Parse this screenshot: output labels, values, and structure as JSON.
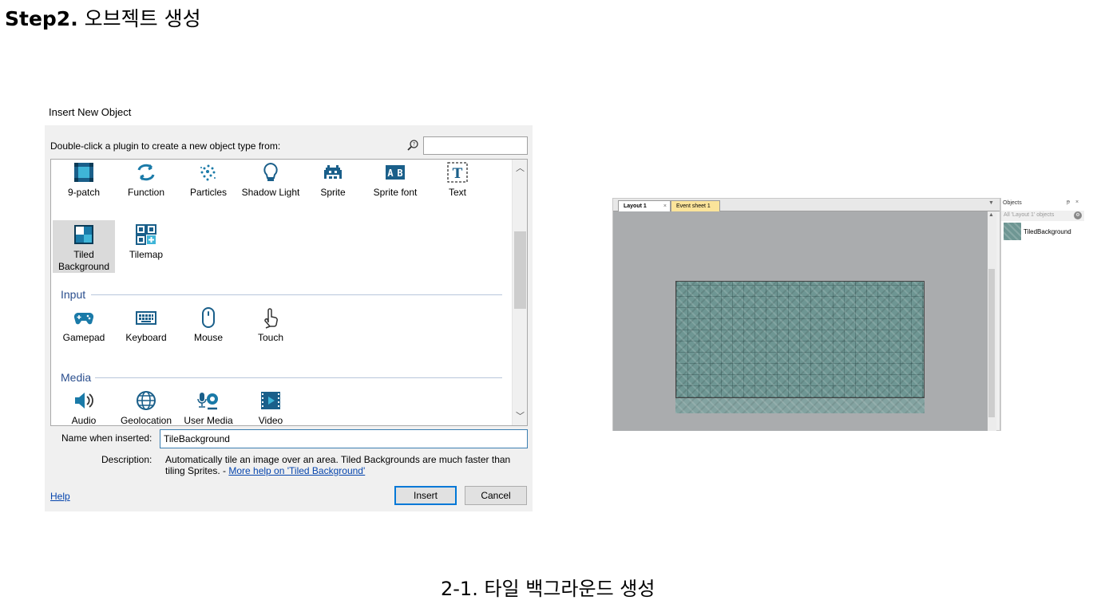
{
  "step": {
    "prefix": "Step2.",
    "title": "오브젝트 생성"
  },
  "dialog": {
    "title": "Insert New Object",
    "instruction": "Double-click a plugin to create a new object type from:",
    "search_value": "",
    "plugins": [
      {
        "label": "9-patch",
        "icon": "nine-patch-icon"
      },
      {
        "label": "Function",
        "icon": "function-icon"
      },
      {
        "label": "Particles",
        "icon": "particles-icon"
      },
      {
        "label": "Shadow Light",
        "icon": "shadow-light-icon"
      },
      {
        "label": "Sprite",
        "icon": "sprite-icon"
      },
      {
        "label": "Sprite font",
        "icon": "sprite-font-icon"
      },
      {
        "label": "Text",
        "icon": "text-icon"
      },
      {
        "label": "Tiled Background",
        "icon": "tiled-background-icon",
        "selected": true
      },
      {
        "label": "Tilemap",
        "icon": "tilemap-icon"
      }
    ],
    "sections": [
      {
        "label": "Input",
        "plugins": [
          {
            "label": "Gamepad",
            "icon": "gamepad-icon"
          },
          {
            "label": "Keyboard",
            "icon": "keyboard-icon"
          },
          {
            "label": "Mouse",
            "icon": "mouse-icon"
          },
          {
            "label": "Touch",
            "icon": "touch-icon"
          }
        ]
      },
      {
        "label": "Media",
        "plugins": [
          {
            "label": "Audio",
            "icon": "audio-icon"
          },
          {
            "label": "Geolocation",
            "icon": "geolocation-icon"
          },
          {
            "label": "User Media",
            "icon": "user-media-icon"
          },
          {
            "label": "Video",
            "icon": "video-icon"
          }
        ]
      }
    ],
    "name_label": "Name when inserted:",
    "name_value": "TileBackground",
    "description_label": "Description:",
    "description_text": "Automatically tile an image over an area.  Tiled Backgrounds are much faster than tiling Sprites. - ",
    "description_link": "More help on 'Tiled Background'",
    "help_label": "Help",
    "insert_label": "Insert",
    "cancel_label": "Cancel",
    "accent_color": "#0078d7"
  },
  "editor": {
    "tabs": [
      {
        "label": "Layout 1",
        "active": true,
        "close": "×"
      },
      {
        "label": "Event sheet 1",
        "active": false
      }
    ],
    "objects_panel": {
      "title": "Objects",
      "filter_text": "All 'Layout 1' objects",
      "items": [
        {
          "name": "TiledBackground"
        }
      ]
    },
    "tile_color": "#6e9693"
  },
  "caption": "2-1. 타일 백그라운드 생성"
}
